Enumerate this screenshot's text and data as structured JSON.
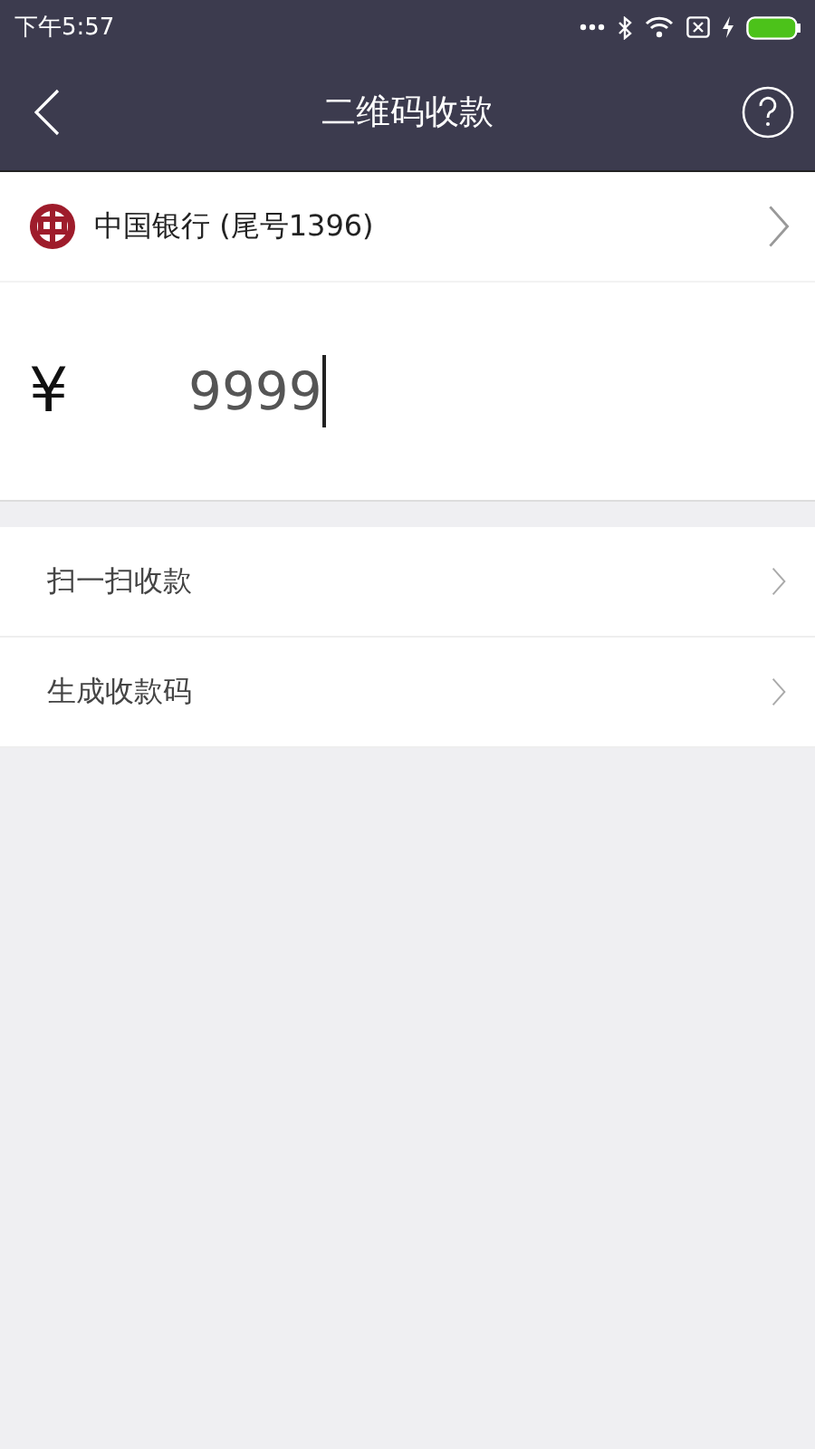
{
  "status_bar": {
    "time": "下午5:57"
  },
  "header": {
    "title": "二维码收款"
  },
  "account": {
    "bank": "中国银行",
    "suffix": "(尾号1396)"
  },
  "amount": {
    "currency": "¥",
    "value": "9999"
  },
  "menu": [
    {
      "label": "扫一扫收款"
    },
    {
      "label": "生成收款码"
    }
  ]
}
